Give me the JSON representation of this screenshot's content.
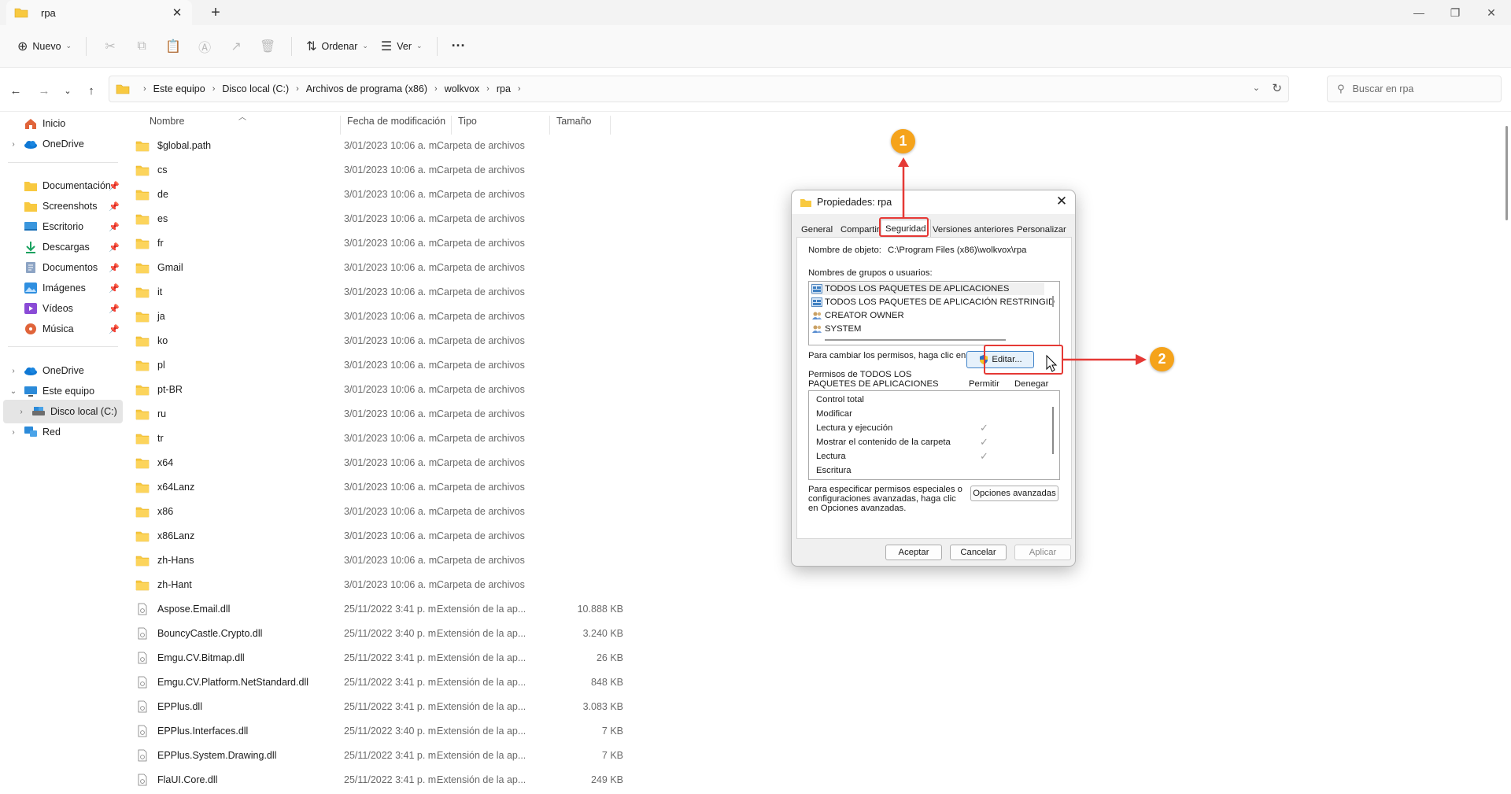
{
  "window": {
    "tab_title": "rpa",
    "close_glyph": "✕",
    "new_tab_glyph": "+",
    "minimize_glyph": "—",
    "maximize_glyph": "❐",
    "window_close_glyph": "✕"
  },
  "toolbar": {
    "new_label": "Nuevo",
    "sort_label": "Ordenar",
    "view_label": "Ver",
    "more_glyph": "···",
    "disabled_icons": [
      "cut-icon",
      "copy-icon",
      "paste-icon",
      "rename-icon",
      "share-icon",
      "delete-icon"
    ]
  },
  "address": {
    "crumbs": [
      "Este equipo",
      "Disco local (C:)",
      "Archivos de programa (x86)",
      "wolkvox",
      "rpa"
    ],
    "search_placeholder": "Buscar en rpa"
  },
  "sidebar": {
    "items": [
      {
        "label": "Inicio",
        "icon": "home-icon",
        "expandable": false,
        "pinned": false
      },
      {
        "label": "OneDrive",
        "icon": "cloud-icon",
        "expandable": true,
        "pinned": false
      },
      {
        "label": "Documentación",
        "icon": "folder-icon",
        "expandable": false,
        "pinned": true
      },
      {
        "label": "Screenshots",
        "icon": "folder-icon",
        "expandable": false,
        "pinned": true
      },
      {
        "label": "Escritorio",
        "icon": "desktop-icon",
        "expandable": false,
        "pinned": true
      },
      {
        "label": "Descargas",
        "icon": "download-icon",
        "expandable": false,
        "pinned": true
      },
      {
        "label": "Documentos",
        "icon": "document-icon",
        "expandable": false,
        "pinned": true
      },
      {
        "label": "Imágenes",
        "icon": "image-icon",
        "expandable": false,
        "pinned": true
      },
      {
        "label": "Vídeos",
        "icon": "video-icon",
        "expandable": false,
        "pinned": true
      },
      {
        "label": "Música",
        "icon": "music-icon",
        "expandable": false,
        "pinned": true
      },
      {
        "label": "OneDrive",
        "icon": "cloud-icon",
        "expandable": true,
        "pinned": false
      },
      {
        "label": "Este equipo",
        "icon": "computer-icon",
        "expandable": true,
        "pinned": false
      },
      {
        "label": "Disco local (C:)",
        "icon": "drive-icon",
        "expandable": true,
        "pinned": false
      },
      {
        "label": "Red",
        "icon": "network-icon",
        "expandable": true,
        "pinned": false
      }
    ],
    "pin_glyph": "📌"
  },
  "filelist": {
    "headers": {
      "name": "Nombre",
      "date": "Fecha de modificación",
      "type": "Tipo",
      "size": "Tamaño"
    },
    "rows": [
      {
        "name": "$global.path",
        "date": "3/01/2023 10:06 a. m.",
        "type": "Carpeta de archivos",
        "size": "",
        "kind": "folder"
      },
      {
        "name": "cs",
        "date": "3/01/2023 10:06 a. m.",
        "type": "Carpeta de archivos",
        "size": "",
        "kind": "folder"
      },
      {
        "name": "de",
        "date": "3/01/2023 10:06 a. m.",
        "type": "Carpeta de archivos",
        "size": "",
        "kind": "folder"
      },
      {
        "name": "es",
        "date": "3/01/2023 10:06 a. m.",
        "type": "Carpeta de archivos",
        "size": "",
        "kind": "folder"
      },
      {
        "name": "fr",
        "date": "3/01/2023 10:06 a. m.",
        "type": "Carpeta de archivos",
        "size": "",
        "kind": "folder"
      },
      {
        "name": "Gmail",
        "date": "3/01/2023 10:06 a. m.",
        "type": "Carpeta de archivos",
        "size": "",
        "kind": "folder"
      },
      {
        "name": "it",
        "date": "3/01/2023 10:06 a. m.",
        "type": "Carpeta de archivos",
        "size": "",
        "kind": "folder"
      },
      {
        "name": "ja",
        "date": "3/01/2023 10:06 a. m.",
        "type": "Carpeta de archivos",
        "size": "",
        "kind": "folder"
      },
      {
        "name": "ko",
        "date": "3/01/2023 10:06 a. m.",
        "type": "Carpeta de archivos",
        "size": "",
        "kind": "folder"
      },
      {
        "name": "pl",
        "date": "3/01/2023 10:06 a. m.",
        "type": "Carpeta de archivos",
        "size": "",
        "kind": "folder"
      },
      {
        "name": "pt-BR",
        "date": "3/01/2023 10:06 a. m.",
        "type": "Carpeta de archivos",
        "size": "",
        "kind": "folder"
      },
      {
        "name": "ru",
        "date": "3/01/2023 10:06 a. m.",
        "type": "Carpeta de archivos",
        "size": "",
        "kind": "folder"
      },
      {
        "name": "tr",
        "date": "3/01/2023 10:06 a. m.",
        "type": "Carpeta de archivos",
        "size": "",
        "kind": "folder"
      },
      {
        "name": "x64",
        "date": "3/01/2023 10:06 a. m.",
        "type": "Carpeta de archivos",
        "size": "",
        "kind": "folder"
      },
      {
        "name": "x64Lanz",
        "date": "3/01/2023 10:06 a. m.",
        "type": "Carpeta de archivos",
        "size": "",
        "kind": "folder"
      },
      {
        "name": "x86",
        "date": "3/01/2023 10:06 a. m.",
        "type": "Carpeta de archivos",
        "size": "",
        "kind": "folder"
      },
      {
        "name": "x86Lanz",
        "date": "3/01/2023 10:06 a. m.",
        "type": "Carpeta de archivos",
        "size": "",
        "kind": "folder"
      },
      {
        "name": "zh-Hans",
        "date": "3/01/2023 10:06 a. m.",
        "type": "Carpeta de archivos",
        "size": "",
        "kind": "folder"
      },
      {
        "name": "zh-Hant",
        "date": "3/01/2023 10:06 a. m.",
        "type": "Carpeta de archivos",
        "size": "",
        "kind": "folder"
      },
      {
        "name": "Aspose.Email.dll",
        "date": "25/11/2022 3:41 p. m.",
        "type": "Extensión de la ap...",
        "size": "10.888 KB",
        "kind": "file"
      },
      {
        "name": "BouncyCastle.Crypto.dll",
        "date": "25/11/2022 3:40 p. m.",
        "type": "Extensión de la ap...",
        "size": "3.240 KB",
        "kind": "file"
      },
      {
        "name": "Emgu.CV.Bitmap.dll",
        "date": "25/11/2022 3:41 p. m.",
        "type": "Extensión de la ap...",
        "size": "26 KB",
        "kind": "file"
      },
      {
        "name": "Emgu.CV.Platform.NetStandard.dll",
        "date": "25/11/2022 3:41 p. m.",
        "type": "Extensión de la ap...",
        "size": "848 KB",
        "kind": "file"
      },
      {
        "name": "EPPlus.dll",
        "date": "25/11/2022 3:41 p. m.",
        "type": "Extensión de la ap...",
        "size": "3.083 KB",
        "kind": "file"
      },
      {
        "name": "EPPlus.Interfaces.dll",
        "date": "25/11/2022 3:40 p. m.",
        "type": "Extensión de la ap...",
        "size": "7 KB",
        "kind": "file"
      },
      {
        "name": "EPPlus.System.Drawing.dll",
        "date": "25/11/2022 3:41 p. m.",
        "type": "Extensión de la ap...",
        "size": "7 KB",
        "kind": "file"
      },
      {
        "name": "FlaUI.Core.dll",
        "date": "25/11/2022 3:41 p. m.",
        "type": "Extensión de la ap...",
        "size": "249 KB",
        "kind": "file"
      }
    ]
  },
  "dialog": {
    "title": "Propiedades: rpa",
    "tabs": [
      "General",
      "Compartir",
      "Seguridad",
      "Versiones anteriores",
      "Personalizar"
    ],
    "object_name_label": "Nombre de objeto:",
    "object_name_value": "C:\\Program Files (x86)\\wolkvox\\rpa",
    "groups_label": "Nombres de grupos o usuarios:",
    "groups": [
      "TODOS LOS PAQUETES DE APLICACIONES",
      "TODOS LOS PAQUETES DE APLICACIÓN RESTRINGID",
      "CREATOR OWNER",
      "SYSTEM"
    ],
    "change_perm_text": "Para cambiar los permisos, haga clic en Editar.",
    "edit_button": "Editar...",
    "perms_for_line1": "Permisos de TODOS LOS",
    "perms_for_line2": "PAQUETES DE APLICACIONES",
    "allow_header": "Permitir",
    "deny_header": "Denegar",
    "permissions": [
      {
        "label": "Control total",
        "allow": false
      },
      {
        "label": "Modificar",
        "allow": false
      },
      {
        "label": "Lectura y ejecución",
        "allow": true
      },
      {
        "label": "Mostrar el contenido de la carpeta",
        "allow": true
      },
      {
        "label": "Lectura",
        "allow": true
      },
      {
        "label": "Escritura",
        "allow": false
      }
    ],
    "check_glyph": "✓",
    "advanced_text_1": "Para especificar permisos especiales o",
    "advanced_text_2": "configuraciones avanzadas, haga clic",
    "advanced_text_3": "en Opciones avanzadas.",
    "advanced_button": "Opciones avanzadas",
    "ok_button": "Aceptar",
    "cancel_button": "Cancelar",
    "apply_button": "Aplicar"
  },
  "annotations": {
    "badge_1": "1",
    "badge_2": "2",
    "color_highlight": "#e53935",
    "color_badge": "#f5a31b"
  },
  "colors": {
    "folder_yellow": "#f8c940",
    "accent_blue": "#0067c0"
  }
}
